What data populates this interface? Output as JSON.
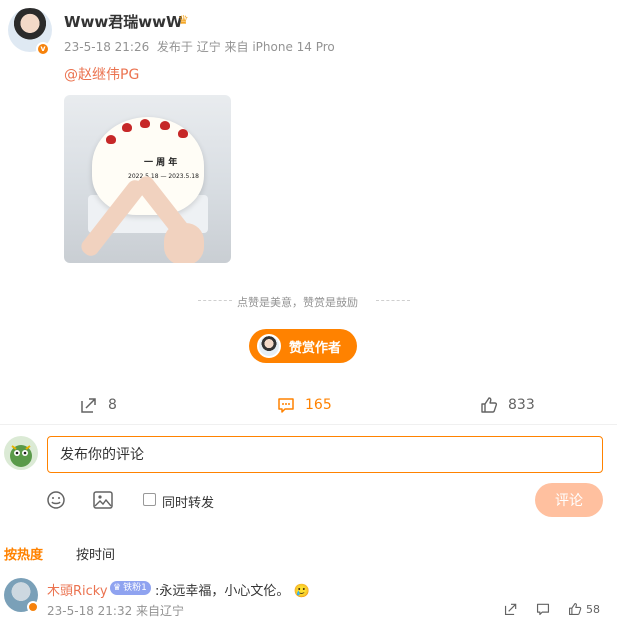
{
  "post": {
    "username": "Www君瑞wwW",
    "time": "23-5-18 21:26",
    "source": "发布于 辽宁 来自 iPhone 14 Pro",
    "mention": "@赵继伟PG"
  },
  "reward": {
    "tip": "点赞是美意，赞赏是鼓励",
    "button_label": "赞赏作者"
  },
  "actions": {
    "repost_count": "8",
    "comment_count": "165",
    "like_count": "833"
  },
  "composer": {
    "placeholder": "发布你的评论",
    "repost_label": "同时转发",
    "submit_label": "评论"
  },
  "sort_tabs": {
    "hot": "按热度",
    "time": "按时间"
  },
  "comments": [
    {
      "name": "木頭Ricky",
      "fan_badge": "铁粉1",
      "text": ":永远幸福，小心文伦。",
      "meta": "23-5-18 21:32 来自辽宁",
      "likes": "58"
    }
  ],
  "colors": {
    "accent": "#ff8200",
    "link": "#eb7350"
  }
}
